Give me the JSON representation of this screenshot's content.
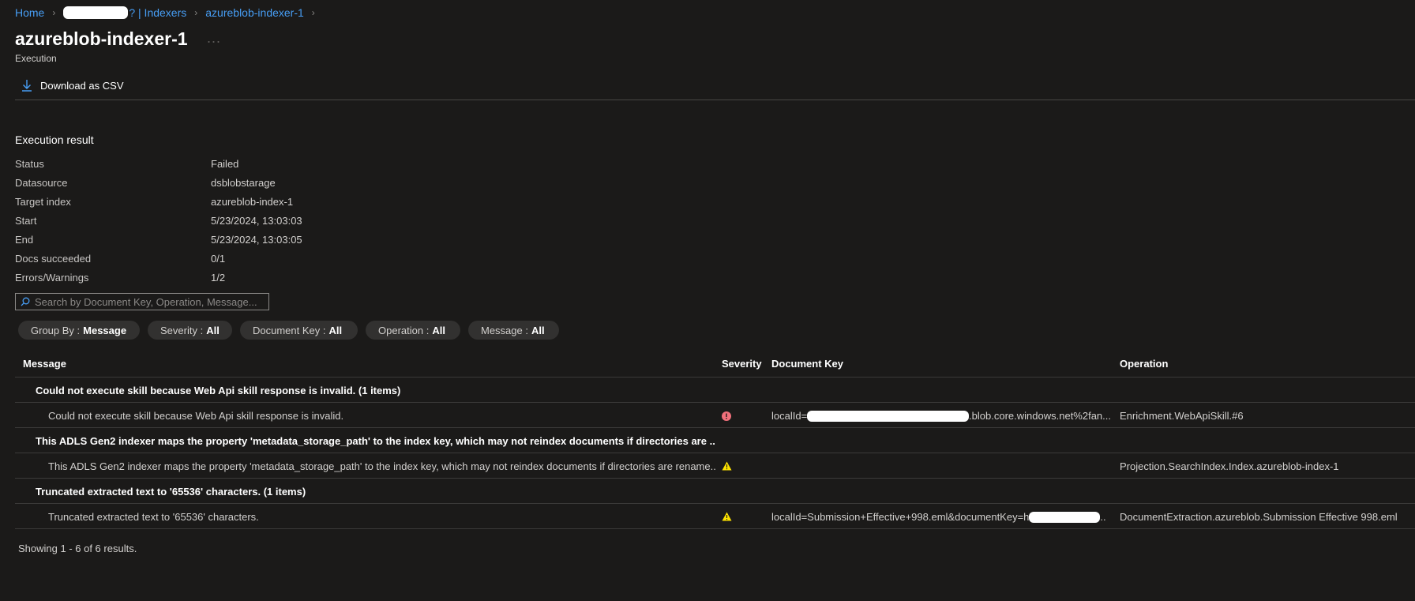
{
  "breadcrumb": {
    "home": "Home",
    "service_suffix": "? | Indexers",
    "current": "azureblob-indexer-1"
  },
  "page": {
    "title": "azureblob-indexer-1",
    "title_more": "...",
    "subtitle": "Execution"
  },
  "toolbar": {
    "download_label": "Download as CSV",
    "download_icon": "download-icon"
  },
  "execution_result": {
    "heading": "Execution result",
    "rows": [
      {
        "label": "Status",
        "value": "Failed"
      },
      {
        "label": "Datasource",
        "value": "dsblobstarage"
      },
      {
        "label": "Target index",
        "value": "azureblob-index-1"
      },
      {
        "label": "Start",
        "value": "5/23/2024, 13:03:03"
      },
      {
        "label": "End",
        "value": "5/23/2024, 13:03:05"
      },
      {
        "label": "Docs succeeded",
        "value": "0/1"
      },
      {
        "label": "Errors/Warnings",
        "value": "1/2"
      }
    ]
  },
  "search": {
    "placeholder": "Search by Document Key, Operation, Message..."
  },
  "filters": [
    {
      "label": "Group By :",
      "value": "Message"
    },
    {
      "label": "Severity :",
      "value": "All"
    },
    {
      "label": "Document Key :",
      "value": "All"
    },
    {
      "label": "Operation :",
      "value": "All"
    },
    {
      "label": "Message :",
      "value": "All"
    }
  ],
  "table": {
    "columns": [
      "Message",
      "Severity",
      "Document Key",
      "Operation"
    ],
    "groups": [
      {
        "header": "Could not execute skill because Web Api skill response is invalid. (1 items)",
        "row": {
          "message": "Could not execute skill because Web Api skill response is invalid.",
          "severity": "error",
          "doc_key_prefix": "localId=",
          "doc_key_suffix": ".blob.core.windows.net%2fan...",
          "operation": "Enrichment.WebApiSkill.#6"
        }
      },
      {
        "header": "This ADLS Gen2 indexer maps the property 'metadata_storage_path' to the index key, which may not reindex documents if directories are ...",
        "row": {
          "message": "This ADLS Gen2 indexer maps the property 'metadata_storage_path' to the index key, which may not reindex documents if directories are rename...",
          "severity": "warning",
          "doc_key_prefix": "",
          "doc_key_suffix": "",
          "operation": "Projection.SearchIndex.Index.azureblob-index-1"
        }
      },
      {
        "header": "Truncated extracted text to '65536' characters. (1 items)",
        "row": {
          "message": "Truncated extracted text to '65536' characters.",
          "severity": "warning",
          "doc_key_prefix": "localId=Submission+Effective+998.eml&documentKey=h",
          "doc_key_suffix": "..",
          "operation": "DocumentExtraction.azureblob.Submission Effective 998.eml"
        }
      }
    ]
  },
  "footer": {
    "results_text": "Showing 1 - 6 of 6 results."
  },
  "colors": {
    "background": "#1b1a19",
    "link": "#479ef5",
    "error": "#f1707b",
    "warning": "#fce100"
  }
}
